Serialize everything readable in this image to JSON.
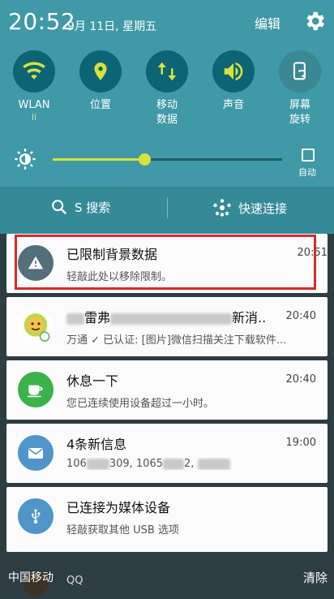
{
  "status": {
    "time": "20:52",
    "date": "9月 11日, 星期五",
    "edit_label": "编辑"
  },
  "toggles": [
    {
      "label": "WLAN",
      "sub": "li",
      "icon": "wifi-icon",
      "on": true
    },
    {
      "label": "位置",
      "sub": "",
      "icon": "location-pin-icon",
      "on": true
    },
    {
      "label": "移动\n数据",
      "sub": "",
      "icon": "mobile-data-icon",
      "on": true
    },
    {
      "label": "声音",
      "sub": "",
      "icon": "sound-icon",
      "on": true
    },
    {
      "label": "屏幕\n旋转",
      "sub": "",
      "icon": "screen-rotation-icon",
      "on": false
    }
  ],
  "brightness": {
    "level": 0.4,
    "auto_label": "自动"
  },
  "actions": {
    "s_search": "S 搜索",
    "quick_connect": "快速连接"
  },
  "notifications": [
    {
      "title": "已限制背景数据",
      "text": "轻敲此处以移除限制。",
      "time": "20:51",
      "icon": "warning-icon",
      "color": "#546e7a"
    },
    {
      "title_prefix": "",
      "title_visible": "雷弗",
      "title_suffix": "新消..",
      "text": "万通 ✓ 已认证: [图片]微信扫描关注下载软件...",
      "time": "20:40",
      "icon": "qq-contact-icon",
      "color": "#ffffff"
    },
    {
      "title": "休息一下",
      "text": "您已连续使用设备超过一小时。",
      "time": "20:40",
      "icon": "coffee-cup-icon",
      "color": "#3bb24a"
    },
    {
      "title": "4条新信息",
      "text_parts": [
        "106",
        "309, 1065",
        "2, "
      ],
      "time": "19:00",
      "icon": "envelope-icon",
      "color": "#4f95c8"
    },
    {
      "title": "已连接为媒体设备",
      "text": "轻敲获取其他 USB 选项",
      "time": "",
      "icon": "usb-icon",
      "color": "#4f95c8"
    }
  ],
  "bottom": {
    "carrier": "中国移动",
    "clear_label": "清除",
    "app_label": "QQ"
  },
  "colors": {
    "panel": "#3f99a7",
    "toggle_on": "#0c6474",
    "accent": "#d7e23c",
    "highlight": "#d52b2b"
  }
}
